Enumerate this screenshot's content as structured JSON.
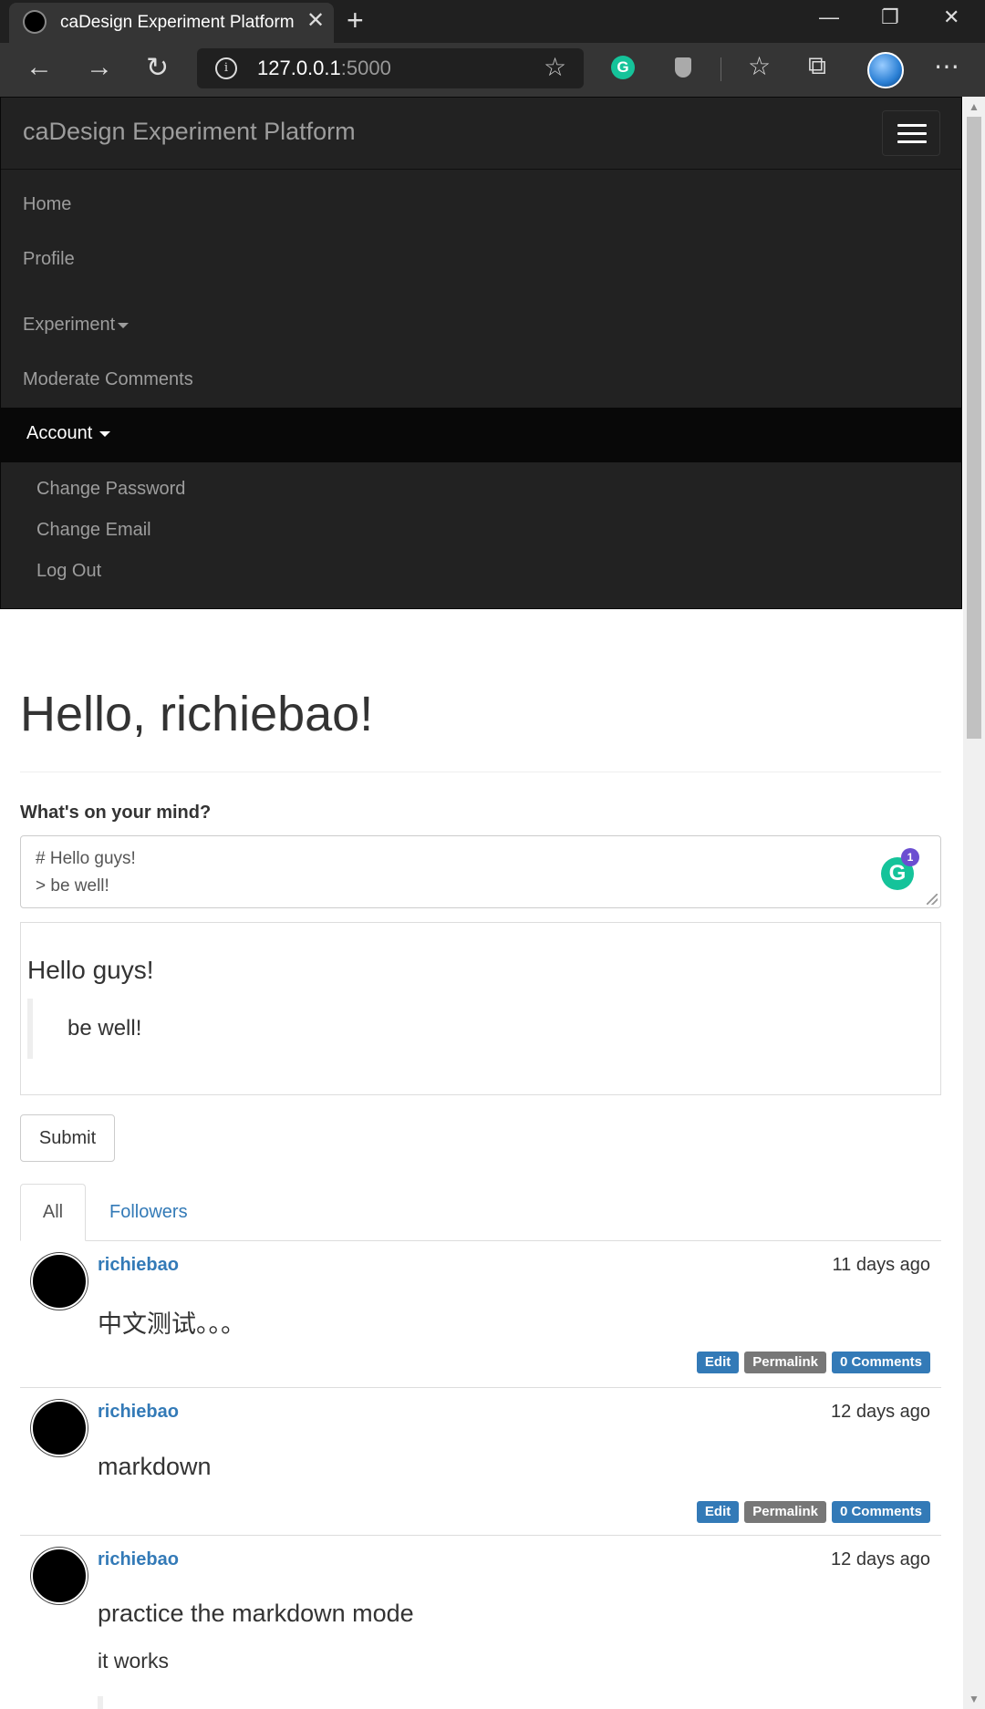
{
  "browser": {
    "tab_title": "caDesign Experiment Platform",
    "close_glyph": "✕",
    "newtab_glyph": "+",
    "minimize_glyph": "—",
    "restore_glyph": "❐",
    "window_close_glyph": "✕",
    "back_glyph": "←",
    "forward_glyph": "→",
    "refresh_glyph": "↻",
    "url_host": "127.0.0.1",
    "url_port": ":5000",
    "star_glyph": "☆",
    "grammarly_glyph": "G",
    "favorites_glyph": "☆",
    "collections_glyph": "⧉",
    "more_glyph": "⋯"
  },
  "nav": {
    "brand": "caDesign Experiment Platform",
    "items": [
      {
        "label": "Home"
      },
      {
        "label": "Profile"
      },
      {
        "label": "Experiment"
      },
      {
        "label": "Moderate Comments"
      }
    ],
    "account": {
      "label": "Account",
      "items": [
        {
          "label": "Change Password"
        },
        {
          "label": "Change Email"
        },
        {
          "label": "Log Out"
        }
      ]
    }
  },
  "page": {
    "title": "Hello, richiebao!",
    "form_label": "What's on your mind?",
    "textarea_value": "# Hello guys!\n> be well!",
    "grammarly_count": "1",
    "preview_heading": "Hello guys!",
    "preview_quote": "be well!",
    "submit_label": "Submit",
    "tabs": [
      {
        "label": "All",
        "active": true
      },
      {
        "label": "Followers",
        "active": false
      }
    ]
  },
  "posts": [
    {
      "author": "richiebao",
      "date": "11 days ago",
      "body": "中文测试。。。",
      "actions": {
        "edit": "Edit",
        "permalink": "Permalink",
        "comments": "0 Comments"
      }
    },
    {
      "author": "richiebao",
      "date": "12 days ago",
      "body": "markdown",
      "actions": {
        "edit": "Edit",
        "permalink": "Permalink",
        "comments": "0 Comments"
      }
    },
    {
      "author": "richiebao",
      "date": "12 days ago",
      "body": "practice the markdown mode",
      "body_line2": "it works"
    }
  ],
  "colors": {
    "link": "#337ab7",
    "navbar": "#222222",
    "badge_primary": "#337ab7",
    "badge_default": "#777777"
  }
}
